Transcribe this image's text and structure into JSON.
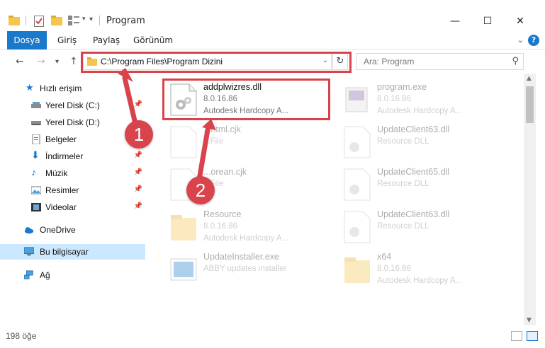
{
  "window": {
    "title": "Program",
    "minimize": "—",
    "maximize": "☐",
    "close": "✕"
  },
  "ribbon": {
    "tabs": [
      "Dosya",
      "Giriş",
      "Paylaş",
      "Görünüm"
    ]
  },
  "nav": {
    "address": "C:\\Program Files\\Program Dizini",
    "search_placeholder": "Ara: Program"
  },
  "sidebar": {
    "items": [
      {
        "label": "Hızlı erişim",
        "icon": "star-icon",
        "pinned": false
      },
      {
        "label": "Yerel Disk (C:)",
        "icon": "drive-icon",
        "pinned": true
      },
      {
        "label": "Yerel Disk (D:)",
        "icon": "drive-icon",
        "pinned": false
      },
      {
        "label": "Belgeler",
        "icon": "documents-icon",
        "pinned": true
      },
      {
        "label": "İndirmeler",
        "icon": "download-icon",
        "pinned": true
      },
      {
        "label": "Müzik",
        "icon": "music-icon",
        "pinned": true
      },
      {
        "label": "Resimler",
        "icon": "pictures-icon",
        "pinned": true
      },
      {
        "label": "Videolar",
        "icon": "videos-icon",
        "pinned": true
      },
      {
        "label": "OneDrive",
        "icon": "cloud-icon",
        "pinned": false
      },
      {
        "label": "Bu bilgisayar",
        "icon": "computer-icon",
        "pinned": false
      },
      {
        "label": "Ağ",
        "icon": "network-icon",
        "pinned": false
      }
    ]
  },
  "files": [
    {
      "name": "addplwizres.dll",
      "line2": "8.0.16.86",
      "line3": "Autodesk Hardcopy A...",
      "icon": "dll-icon",
      "highlighted": true
    },
    {
      "name": "program.exe",
      "line2": "8.0.16.86",
      "line3": "Autodesk Hardcopy A...",
      "icon": "exe-icon"
    },
    {
      "name": "...html.cjk",
      "line2": "...File",
      "line3": "",
      "icon": "file-icon"
    },
    {
      "name": "UpdateClient63.dll",
      "line2": "Resource DLL",
      "line3": "",
      "icon": "dll-icon"
    },
    {
      "name": "...orean.cjk",
      "line2": "...File",
      "line3": "",
      "icon": "file-icon"
    },
    {
      "name": "UpdateClient65.dll",
      "line2": "Resource DLL",
      "line3": "",
      "icon": "dll-icon"
    },
    {
      "name": "Resource",
      "line2": "8.0.16.86",
      "line3": "Autodesk Hardcopy A...",
      "icon": "folder-icon"
    },
    {
      "name": "UpdateClient63.dll",
      "line2": "Resource DLL",
      "line3": "",
      "icon": "dll-icon"
    },
    {
      "name": "UpdateInstaller.exe",
      "line2": "ABBY updates installer",
      "line3": "",
      "icon": "installer-icon"
    },
    {
      "name": "x64",
      "line2": "8.0.16.86",
      "line3": "Autodesk Hardcopy A...",
      "icon": "folder-icon"
    }
  ],
  "status": {
    "count": "198 öğe"
  },
  "callouts": [
    "1",
    "2"
  ],
  "colors": {
    "accent": "#1979ca",
    "highlight": "#d9434b",
    "selected": "#cce8ff"
  }
}
